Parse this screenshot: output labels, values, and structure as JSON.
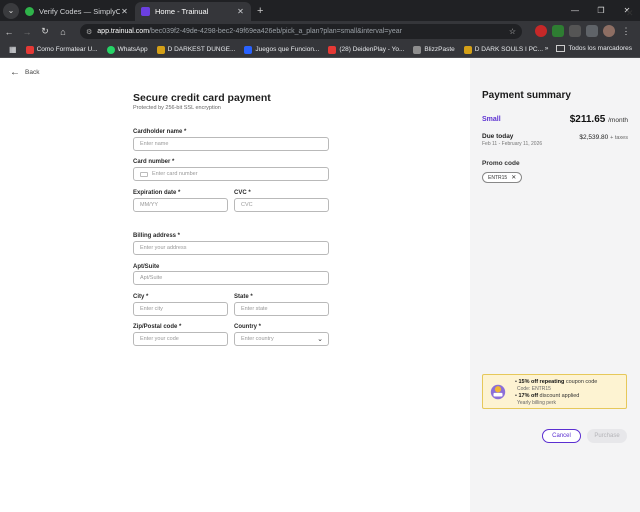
{
  "browser": {
    "tabs": [
      {
        "title": "Verify Codes — SimplyCodes",
        "favicon_color": "#2fb34a"
      },
      {
        "title": "Home - Trainual",
        "favicon_color": "#6b3fe0"
      }
    ],
    "url_host": "app.trainual.com",
    "url_path": "/bec039f2-49de-4298-bec2-49f69ea426eb/pick_a_plan?plan=small&interval=year",
    "bookmarks": [
      {
        "label": "Como Formatear U...",
        "color": "#e53935"
      },
      {
        "label": "WhatsApp",
        "color": "#25d366"
      },
      {
        "label": "D DARKEST DUNGE...",
        "color": "#d4a017"
      },
      {
        "label": "Juegos que Funcion...",
        "color": "#2962ff"
      },
      {
        "label": "(28) DeidenPlay - Yo...",
        "color": "#e53935"
      },
      {
        "label": "BlizzPaste",
        "color": "#8e8e8e"
      },
      {
        "label": "D DARK SOULS I PC...",
        "color": "#d4a017"
      }
    ],
    "bookmarks_all": "Todos los marcadores"
  },
  "page": {
    "back_label": "Back",
    "title": "Secure credit card payment",
    "subtitle": "Protected by 256-bit SSL encryption",
    "fields": {
      "cardholder": {
        "label": "Cardholder name *",
        "placeholder": "Enter name"
      },
      "card_number": {
        "label": "Card number *",
        "placeholder": "Enter card number"
      },
      "expiration": {
        "label": "Expiration date *",
        "placeholder": "MM/YY"
      },
      "cvc": {
        "label": "CVC *",
        "placeholder": "CVC"
      },
      "billing_address": {
        "label": "Billing address *",
        "placeholder": "Enter your address"
      },
      "apt": {
        "label": "Apt/Suite",
        "placeholder": "Apt/Suite"
      },
      "city": {
        "label": "City *",
        "placeholder": "Enter city"
      },
      "state": {
        "label": "State *",
        "placeholder": "Enter state"
      },
      "zip": {
        "label": "Zip/Postal code *",
        "placeholder": "Enter your code"
      },
      "country": {
        "label": "Country *",
        "placeholder": "Enter country"
      }
    }
  },
  "summary": {
    "title": "Payment summary",
    "plan": "Small",
    "price": "$211.65",
    "price_period": "/month",
    "due_label": "Due today",
    "due_dates": "Feb 11 - February 11, 2026",
    "due_amount": "$2,539.80",
    "due_taxes": "+ taxes",
    "promo_label": "Promo code",
    "promo_code": "ENTR15",
    "coupon": {
      "line1_bold": "15% off repeating",
      "line1_rest": " coupon code",
      "line2": "Code: ENTR15",
      "line3_bold": "17% off",
      "line3_rest": " discount applied",
      "line4": "Yearly billing perk"
    },
    "cancel_label": "Cancel",
    "purchase_label": "Purchase"
  },
  "colors": {
    "accent": "#5b2fd1",
    "panel_bg": "#f4f4f5",
    "coupon_bg": "#fdf3d2"
  }
}
